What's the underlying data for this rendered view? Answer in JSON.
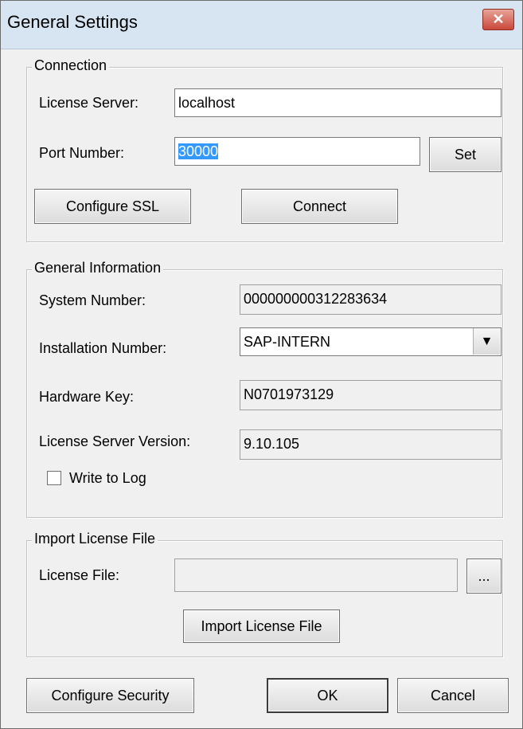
{
  "window": {
    "title": "General Settings",
    "close_glyph": "✕"
  },
  "connection": {
    "legend": "Connection",
    "license_server_label": "License Server:",
    "license_server_value": "localhost",
    "port_label": "Port Number:",
    "port_value": "30000",
    "set_label": "Set",
    "configure_ssl_label": "Configure SSL",
    "connect_label": "Connect"
  },
  "general_info": {
    "legend": "General Information",
    "system_number_label": "System Number:",
    "system_number_value": "000000000312283634",
    "installation_label": "Installation Number:",
    "installation_value": "SAP-INTERN",
    "hardware_key_label": "Hardware Key:",
    "hardware_key_value": "N0701973129",
    "server_version_label": "License Server Version:",
    "server_version_value": "9.10.105",
    "write_log_label": "Write to Log",
    "write_log_checked": false
  },
  "import": {
    "legend": "Import License File",
    "license_file_label": "License File:",
    "license_file_value": "",
    "browse_label": "...",
    "import_label": "Import License File"
  },
  "footer": {
    "configure_security_label": "Configure Security",
    "ok_label": "OK",
    "cancel_label": "Cancel"
  },
  "icons": {
    "dropdown": "chevron-down-icon",
    "close": "close-icon"
  },
  "colors": {
    "selection": "#3399ff",
    "dialog_bg": "#f0f0f0",
    "close_button": "#c9483a"
  }
}
